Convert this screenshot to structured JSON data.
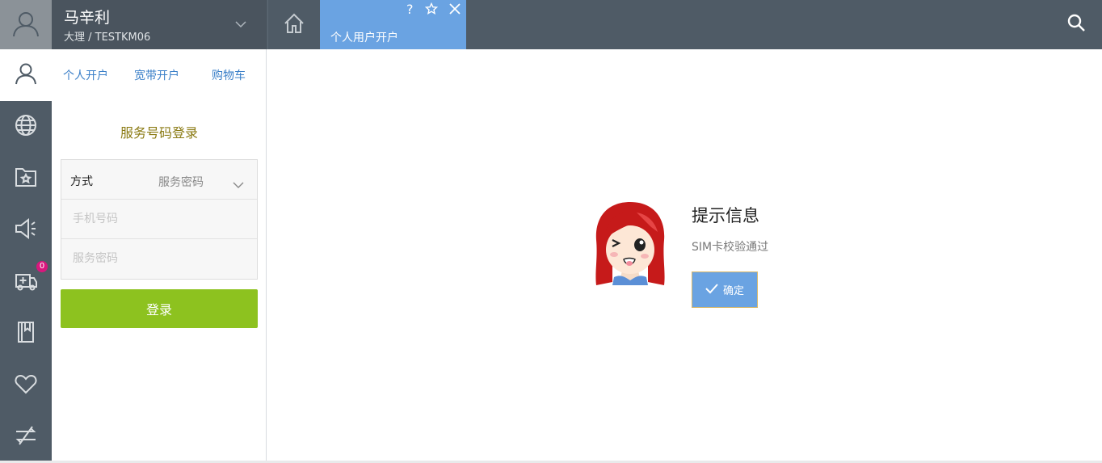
{
  "user": {
    "name": "马辛利",
    "location": "大理 / TESTKM06"
  },
  "tab": {
    "label": "个人用户开户",
    "help": "?"
  },
  "rail": {
    "cart_count": "0"
  },
  "subnav": [
    {
      "label": "个人开户"
    },
    {
      "label": "宽带开户"
    },
    {
      "label": "购物车"
    }
  ],
  "login": {
    "title": "服务号码登录",
    "method_label": "方式",
    "method_value": "服务密码",
    "phone_placeholder": "手机号码",
    "password_placeholder": "服务密码",
    "submit_label": "登录"
  },
  "dialog": {
    "title": "提示信息",
    "message": "SIM卡校验通过",
    "confirm_label": "确定"
  },
  "colors": {
    "header_bg": "#4f5b66",
    "tab_active": "#6aa3e2",
    "login_button": "#8dc21f",
    "link": "#3a7fc8",
    "section_title": "#8a7a12",
    "badge": "#d8177d"
  },
  "icons": [
    "user-icon",
    "chevron-down-icon",
    "home-icon",
    "star-icon",
    "close-icon",
    "search-icon",
    "globe-icon",
    "folder-star-icon",
    "megaphone-icon",
    "ambulance-icon",
    "book-icon",
    "heart-icon",
    "swap-icon",
    "check-icon"
  ]
}
